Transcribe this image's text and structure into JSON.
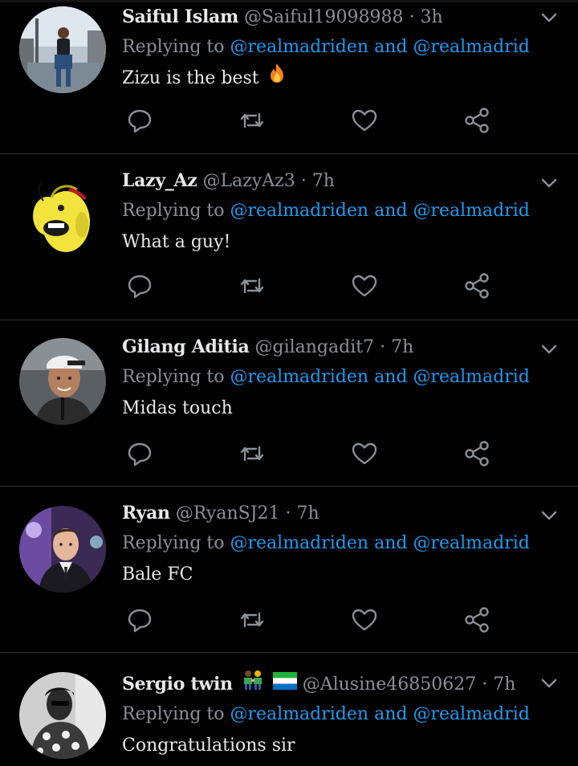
{
  "tweets": [
    {
      "display_name": "Saiful Islam",
      "handle": "@Saiful19098988",
      "time": "3h",
      "replying_prefix": "Replying to",
      "mention1": "@realmadriden",
      "conj": "and",
      "mention2": "@realmadrid",
      "text": "Zizu is the best",
      "emoji": "fire-icon"
    },
    {
      "display_name": "Lazy_Az",
      "handle": "@LazyAz3",
      "time": "7h",
      "replying_prefix": "Replying to",
      "mention1": "@realmadriden",
      "conj": "and",
      "mention2": "@realmadrid",
      "text": "What a guy!"
    },
    {
      "display_name": "Gilang Aditia",
      "handle": "@gilangadit7",
      "time": "7h",
      "replying_prefix": "Replying to",
      "mention1": "@realmadriden",
      "conj": "and",
      "mention2": "@realmadrid",
      "text": "Midas touch"
    },
    {
      "display_name": "Ryan",
      "handle": "@RyanSJ21",
      "time": "7h",
      "replying_prefix": "Replying to",
      "mention1": "@realmadriden",
      "conj": "and",
      "mention2": "@realmadrid",
      "text": "Bale FC"
    },
    {
      "display_name": "Sergio twin",
      "handle": "@Alusine46850627",
      "time": "7h",
      "replying_prefix": "Replying to",
      "mention1": "@realmadriden",
      "conj": "and",
      "mention2": "@realmadrid",
      "text": "Congratulations sir",
      "name_emojis": [
        "couple-icon",
        "sierra-leone-flag-icon"
      ]
    }
  ],
  "separator": "·",
  "colors": {
    "background": "#000000",
    "text": "#e7e9ea",
    "secondary": "#8b9096",
    "link": "#1d9bf0",
    "divider": "#2f3336"
  },
  "actions": [
    "reply-icon",
    "retweet-icon",
    "like-icon",
    "share-icon"
  ]
}
